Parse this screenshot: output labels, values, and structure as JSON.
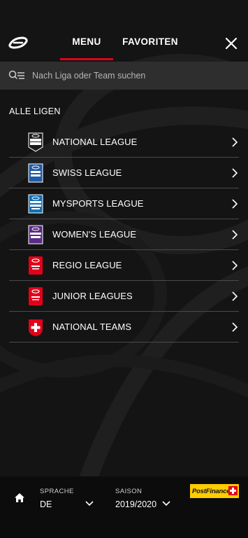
{
  "header": {
    "tabs": [
      {
        "label": "MENU",
        "active": true
      },
      {
        "label": "FAVORITEN",
        "active": false
      }
    ],
    "accent_color": "#e2001a"
  },
  "search": {
    "placeholder": "Nach Liga oder Team suchen"
  },
  "section": {
    "title": "ALLE LIGEN"
  },
  "leagues": [
    {
      "label": "NATIONAL LEAGUE",
      "icon": "national-league-logo-icon"
    },
    {
      "label": "SWISS LEAGUE",
      "icon": "swiss-league-logo-icon"
    },
    {
      "label": "MYSPORTS LEAGUE",
      "icon": "mysports-league-logo-icon"
    },
    {
      "label": "WOMEN'S LEAGUE",
      "icon": "womens-league-logo-icon"
    },
    {
      "label": "REGIO LEAGUE",
      "icon": "regio-league-logo-icon"
    },
    {
      "label": "JUNIOR LEAGUES",
      "icon": "junior-leagues-logo-icon"
    },
    {
      "label": "NATIONAL TEAMS",
      "icon": "swiss-cross-icon"
    }
  ],
  "footer": {
    "language_label": "SPRACHE",
    "language_value": "DE",
    "season_label": "SAISON",
    "season_value": "2019/2020",
    "sponsor": "PostFinance"
  }
}
